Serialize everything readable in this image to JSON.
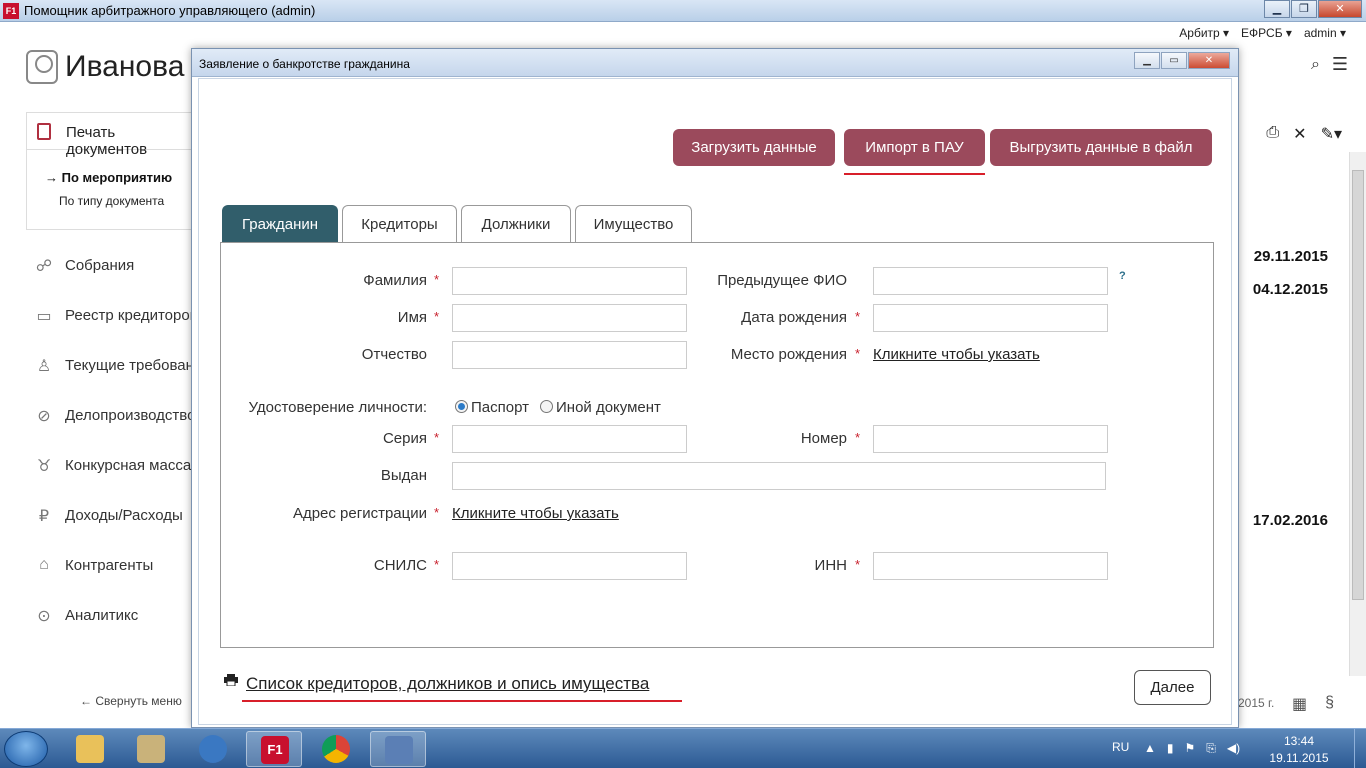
{
  "window": {
    "app_icon": "F1",
    "title": "Помощник арбитражного управляющего (admin)",
    "buttons": {
      "minimize": "▁",
      "maximize": "❐",
      "close": "✕"
    }
  },
  "topnav": [
    "Арбитр ▾",
    "ЕФРСБ ▾",
    "admin ▾"
  ],
  "header": {
    "user_name": "Иванова"
  },
  "print_panel": {
    "title": "Печать документов",
    "links": [
      "→ По мероприятию",
      "По типу документа"
    ]
  },
  "sidebar": {
    "items": [
      {
        "label": "Собрания",
        "icon": "handshake-icon"
      },
      {
        "label": "Реестр кредиторов",
        "icon": "id-card-icon"
      },
      {
        "label": "Текущие требования",
        "icon": "thermometer-icon"
      },
      {
        "label": "Делопроизводство",
        "icon": "paperclip-icon"
      },
      {
        "label": "Конкурсная масса",
        "icon": "cow-icon"
      },
      {
        "label": "Доходы/Расходы",
        "icon": "ruble-icon"
      },
      {
        "label": "Контрагенты",
        "icon": "bank-icon"
      },
      {
        "label": "Аналитикс",
        "icon": "magnifier-icon"
      }
    ],
    "collapse": "Свернуть меню"
  },
  "background_dates": [
    "29.11.2015",
    "04.12.2015",
    "17.02.2016"
  ],
  "footer": {
    "year": "2015 г."
  },
  "dialog": {
    "title": "Заявление о банкротстве гражданина",
    "actions": {
      "load": "Загрузить данные",
      "import": "Импорт в ПАУ",
      "export": "Выгрузить данные в файл"
    },
    "tabs": [
      "Гражданин",
      "Кредиторы",
      "Должники",
      "Имущество"
    ],
    "fields": {
      "surname": {
        "label": "Фамилия",
        "value": ""
      },
      "prev_name": {
        "label": "Предыдущее ФИО",
        "value": ""
      },
      "name": {
        "label": "Имя",
        "value": ""
      },
      "birth_date": {
        "label": "Дата рождения",
        "value": ""
      },
      "patronymic": {
        "label": "Отчество",
        "value": ""
      },
      "birth_place": {
        "label": "Место рождения",
        "link": "Кликните чтобы указать"
      },
      "id_doc": {
        "label": "Удостоверение личности:",
        "options": [
          "Паспорт",
          "Иной документ"
        ],
        "selected": "Паспорт"
      },
      "series": {
        "label": "Серия",
        "value": ""
      },
      "number": {
        "label": "Номер",
        "value": ""
      },
      "issued": {
        "label": "Выдан",
        "value": ""
      },
      "address": {
        "label": "Адрес регистрации",
        "link": "Кликните чтобы указать"
      },
      "snils": {
        "label": "СНИЛС",
        "value": ""
      },
      "inn": {
        "label": "ИНН",
        "value": ""
      }
    },
    "required_mark": "*",
    "help_mark": "?",
    "list_link": "Список кредиторов, должников и опись имущества",
    "next_button": "Далее"
  },
  "taskbar": {
    "lang": "RU",
    "time": "13:44",
    "date": "19.11.2015",
    "apps": [
      "explorer-icon",
      "notebook-icon",
      "thunderbird-icon",
      "f1-app-icon",
      "chrome-icon",
      "network-icon"
    ]
  }
}
